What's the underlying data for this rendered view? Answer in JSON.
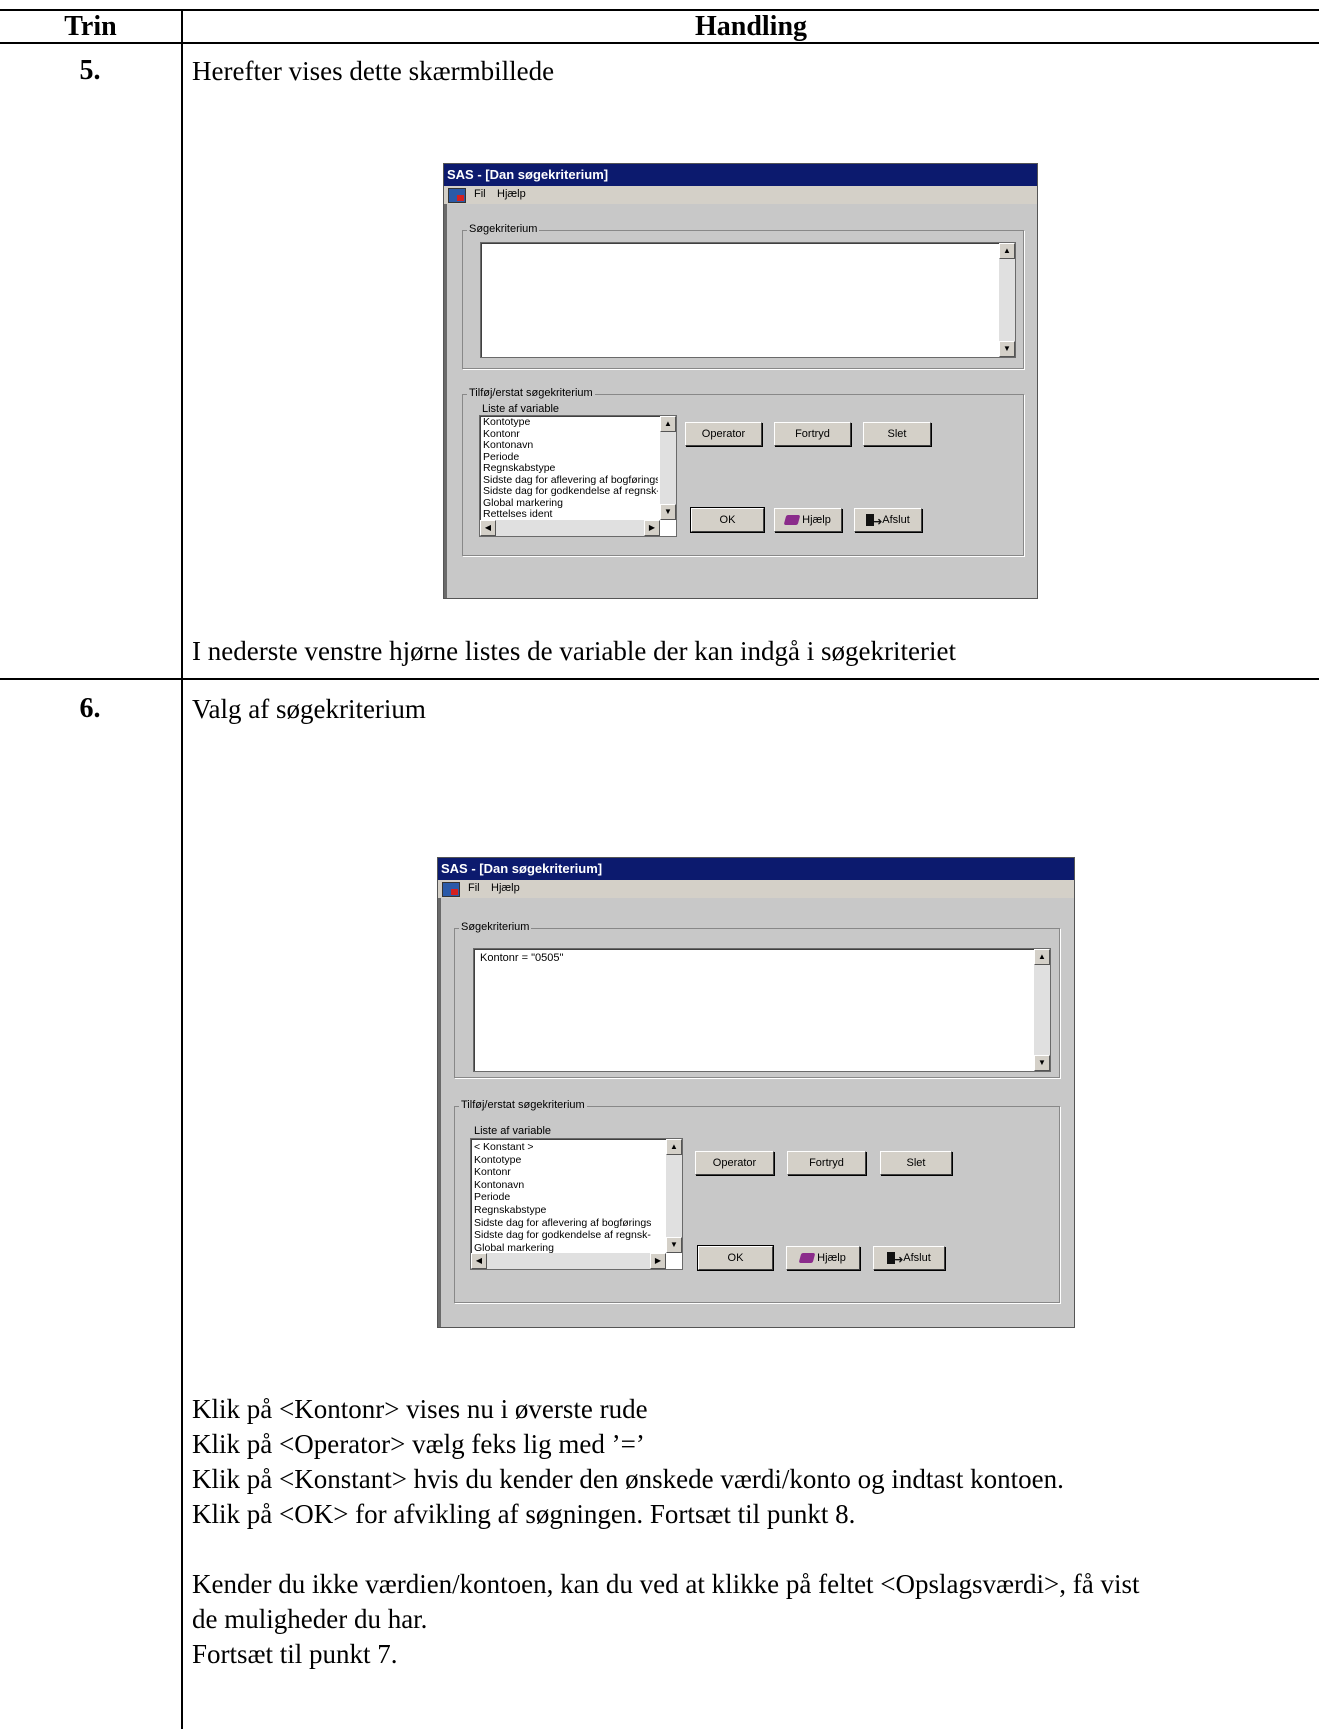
{
  "table": {
    "headers": [
      "Trin",
      "Handling"
    ]
  },
  "steps": [
    {
      "number": "5.",
      "intro": "Herefter vises dette skærmbillede",
      "after": "I nederste venstre hjørne listes de variable der kan indgå i søgekriteriet"
    },
    {
      "number": "6.",
      "intro": "Valg af søgekriterium",
      "lines": [
        "Klik på <Kontonr> vises nu i øverste rude",
        "Klik på <Operator> vælg feks lig med ’=’",
        "Klik på <Konstant> hvis du kender den ønskede værdi/konto og indtast kontoen.",
        "Klik på <OK> for afvikling af søgningen. Fortsæt til punkt 8."
      ],
      "lines2": [
        "Kender du ikke værdien/kontoen, kan du ved at klikke på feltet <Opslagsværdi>, få vist",
        "de muligheder du har.",
        "Fortsæt til punkt 7."
      ]
    }
  ],
  "dialogs": [
    {
      "title": "SAS - [Dan søgekriterium]",
      "menu": [
        "Fil",
        "Hjælp"
      ],
      "criteria_group": "Søgekriterium",
      "criteria_value": "",
      "add_group": "Tilføj/erstat søgekriterium",
      "list_label": "Liste af variable",
      "variables": [
        "Kontotype",
        "Kontonr",
        "Kontonavn",
        "Periode",
        "Regnskabstype",
        "Sidste dag for aflevering af bogførings",
        "Sidste dag for godkendelse af regnsk-",
        "Global markering",
        "Rettelses ident"
      ],
      "buttons": {
        "operator": "Operator",
        "undo": "Fortryd",
        "delete": "Slet",
        "ok": "OK",
        "help": "Hjælp",
        "exit": "Afslut"
      }
    },
    {
      "title": "SAS - [Dan søgekriterium]",
      "menu": [
        "Fil",
        "Hjælp"
      ],
      "criteria_group": "Søgekriterium",
      "criteria_value": "Kontonr = \"0505\"",
      "add_group": "Tilføj/erstat søgekriterium",
      "list_label": "Liste af variable",
      "variables": [
        "< Konstant >",
        "Kontotype",
        "Kontonr",
        "Kontonavn",
        "Periode",
        "Regnskabstype",
        "Sidste dag for aflevering af bogførings",
        "Sidste dag for godkendelse af regnsk-",
        "Global markering"
      ],
      "buttons": {
        "operator": "Operator",
        "undo": "Fortryd",
        "delete": "Slet",
        "ok": "OK",
        "help": "Hjælp",
        "exit": "Afslut"
      }
    }
  ]
}
